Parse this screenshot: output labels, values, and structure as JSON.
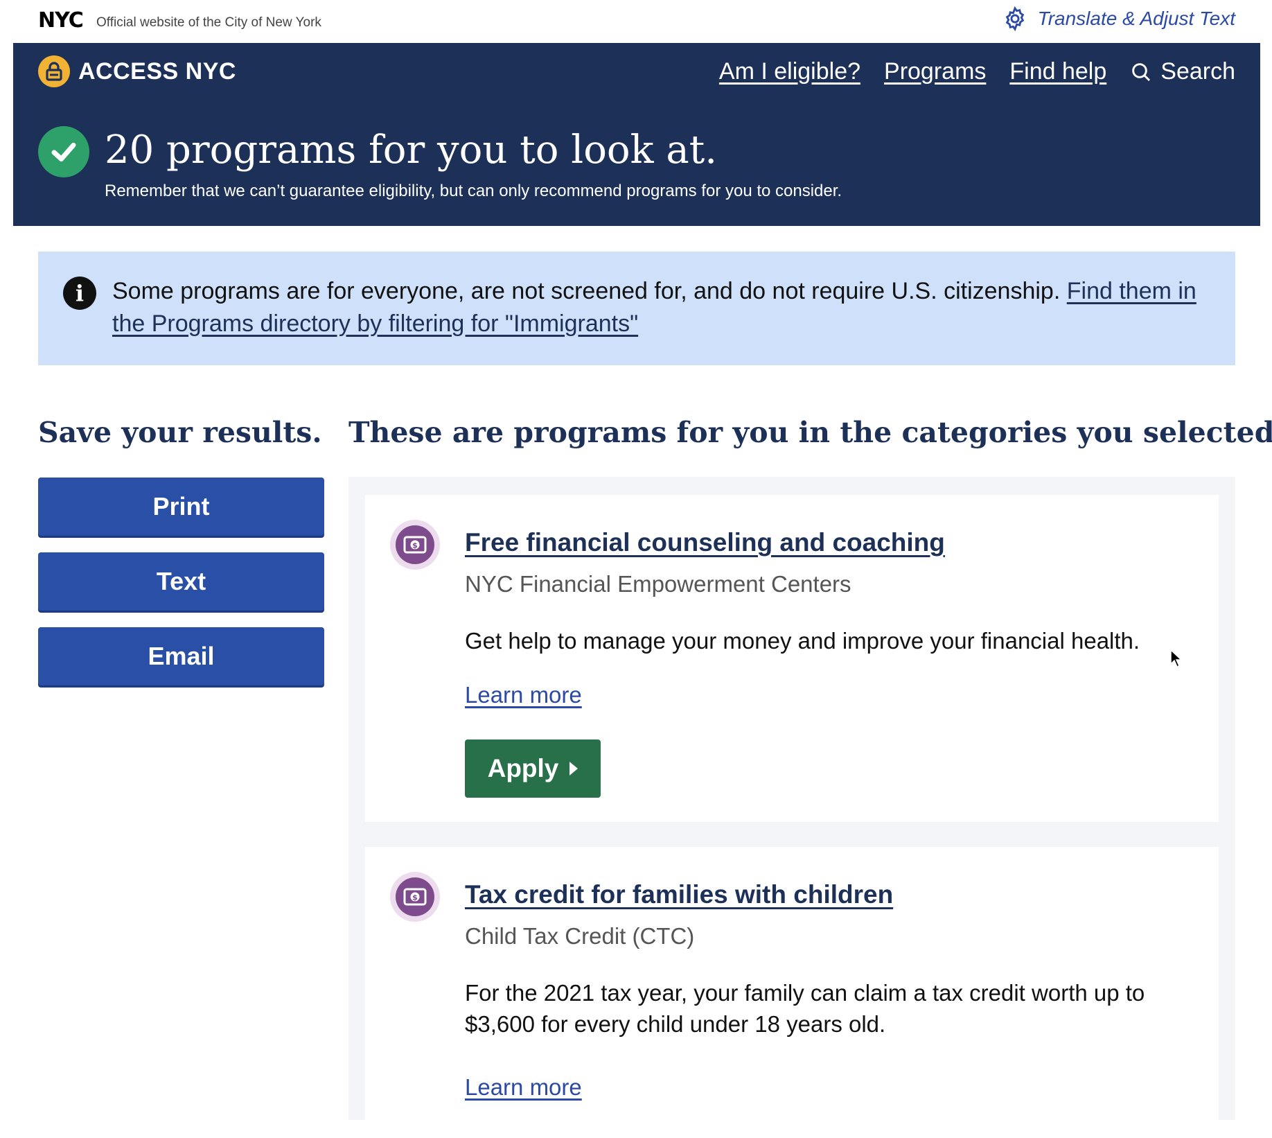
{
  "topbar": {
    "logo": "NYC",
    "official_text": "Official website of the City of New York",
    "translate_label": "Translate & Adjust Text",
    "translate_icon": "gear-icon"
  },
  "header": {
    "brand": "ACCESS NYC",
    "brand_icon": "lock-icon",
    "nav": [
      {
        "label": "Am I eligible?"
      },
      {
        "label": "Programs"
      },
      {
        "label": "Find help"
      }
    ],
    "search_label": "Search",
    "hero_title": "20 programs for you to look at.",
    "hero_subtitle": "Remember that we can’t guarantee eligibility, but can only recommend programs for you to consider.",
    "hero_icon": "check-circle-icon"
  },
  "notice": {
    "icon": "info-icon",
    "text": "Some programs are for everyone, are not screened for, and do not require U.S. citizenship.",
    "link": "Find them in the Programs directory by filtering for \"Immigrants\""
  },
  "save": {
    "title": "Save your results.",
    "buttons": [
      "Print",
      "Text",
      "Email"
    ]
  },
  "results": {
    "title": "These are programs for you in the categories you selected.",
    "programs": [
      {
        "icon": "money-icon",
        "title": "Free financial counseling and coaching",
        "subtitle": "NYC Financial Empowerment Centers",
        "description": "Get help to manage your money and improve your financial health.",
        "learn_more": "Learn more",
        "apply": "Apply"
      },
      {
        "icon": "money-icon",
        "title": "Tax credit for families with children",
        "subtitle": "Child Tax Credit (CTC)",
        "description": "For the 2021 tax year, your family can claim a tax credit worth up to $3,600 for every child under 18 years old.",
        "learn_more": "Learn more"
      }
    ]
  },
  "colors": {
    "header_bg": "#1d3057",
    "notice_bg": "#cfe0fb",
    "button_blue": "#2a4fa6",
    "apply_green": "#27704a",
    "check_green": "#2ea06a",
    "icon_purple": "#7e4c8c",
    "brand_yellow": "#f2b335"
  }
}
